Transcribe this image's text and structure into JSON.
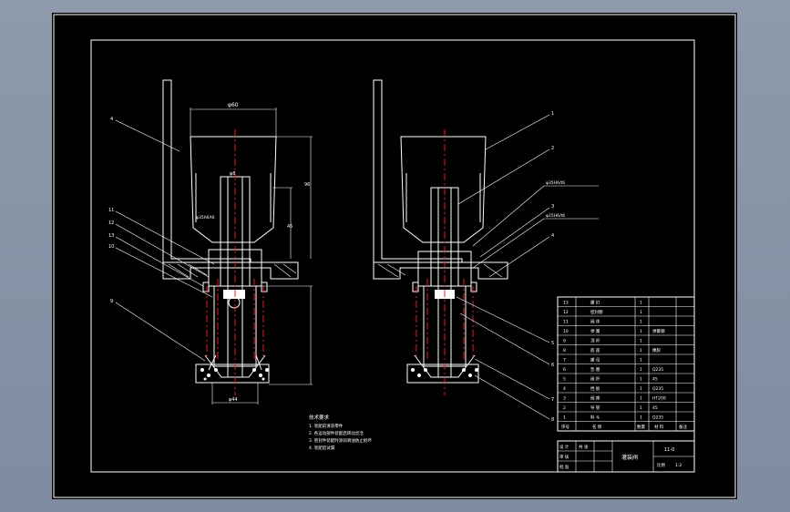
{
  "drawing": {
    "left_view": {
      "dim_top": "φ60",
      "dim_center": "φ8",
      "dim_inner": "φ35h6/t6",
      "dim_right_upper": "96",
      "dim_right_lower": "45",
      "dim_bottom": "φ44",
      "callouts": [
        "4",
        "11",
        "12",
        "13",
        "10",
        "9"
      ]
    },
    "right_view": {
      "dim_fit_1": "φ35H6/t6",
      "dim_fit_2": "φ25H6/t6",
      "callouts": [
        "1",
        "2",
        "3",
        "4",
        "5",
        "6",
        "7",
        "8"
      ]
    },
    "notes": {
      "title": "技术要求",
      "lines": [
        "1. 装配前清洗零件",
        "2. 各运动部件装配后转动灵活",
        "3. 密封件装配时涂润滑油防止损坏",
        "4. 装配后试漏"
      ]
    },
    "parts_list": {
      "rows": [
        {
          "no": "13",
          "name": "螺 钉",
          "qty": "1",
          "material": "",
          "remark": ""
        },
        {
          "no": "12",
          "name": "密封圈",
          "qty": "1",
          "material": "",
          "remark": ""
        },
        {
          "no": "11",
          "name": "阀 体",
          "qty": "1",
          "material": "",
          "remark": ""
        },
        {
          "no": "10",
          "name": "弹 簧",
          "qty": "1",
          "material": "弹簧钢",
          "remark": ""
        },
        {
          "no": "9",
          "name": "顶 杆",
          "qty": "1",
          "material": "",
          "remark": ""
        },
        {
          "no": "8",
          "name": "底 座",
          "qty": "1",
          "material": "橡胶",
          "remark": ""
        },
        {
          "no": "7",
          "name": "螺 母",
          "qty": "1",
          "material": "",
          "remark": ""
        },
        {
          "no": "6",
          "name": "垫 圈",
          "qty": "1",
          "material": "Q235",
          "remark": ""
        },
        {
          "no": "5",
          "name": "阀 杆",
          "qty": "1",
          "material": "45",
          "remark": ""
        },
        {
          "no": "4",
          "name": "挡 板",
          "qty": "1",
          "material": "Q235",
          "remark": ""
        },
        {
          "no": "3",
          "name": "阀 座",
          "qty": "1",
          "material": "HT200",
          "remark": ""
        },
        {
          "no": "2",
          "name": "导 管",
          "qty": "1",
          "material": "45",
          "remark": ""
        },
        {
          "no": "1",
          "name": "料 斗",
          "qty": "1",
          "material": "Q235",
          "remark": ""
        }
      ],
      "header": {
        "no": "序号",
        "name": "名 称",
        "qty": "数量",
        "material": "材 料",
        "remark": "备注"
      }
    },
    "title_block": {
      "drawing_name": "灌装阀",
      "scale_label": "比例",
      "scale_value": "1:2",
      "sheet_label": "共 张",
      "designer_label": "设 计",
      "checker_label": "审 核",
      "approver_label": "批 准",
      "part_no": "11-0"
    }
  }
}
